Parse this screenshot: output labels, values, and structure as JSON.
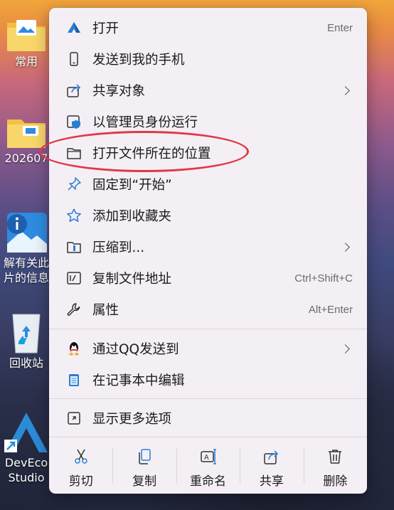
{
  "desktop": {
    "icons": [
      {
        "label": "常用"
      },
      {
        "label": "202607"
      },
      {
        "label_line1": "解有关此",
        "label_line2": "片的信息"
      },
      {
        "label": "回收站"
      },
      {
        "label_line1": "DevEco",
        "label_line2": "Studio"
      }
    ]
  },
  "menu": {
    "items": [
      {
        "label": "打开",
        "shortcut": "Enter",
        "icon": "open-icon"
      },
      {
        "label": "发送到我的手机",
        "icon": "phone-icon"
      },
      {
        "label": "共享对象",
        "icon": "share-icon",
        "submenu": true
      },
      {
        "label": "以管理员身份运行",
        "icon": "admin-shield-icon"
      },
      {
        "label": "打开文件所在的位置",
        "icon": "folder-icon"
      },
      {
        "label": "固定到“开始”",
        "icon": "pin-icon"
      },
      {
        "label": "添加到收藏夹",
        "icon": "star-icon"
      },
      {
        "label": "压缩到...",
        "icon": "zip-icon",
        "submenu": true
      },
      {
        "label": "复制文件地址",
        "shortcut": "Ctrl+Shift+C",
        "icon": "copy-path-icon"
      },
      {
        "label": "属性",
        "shortcut": "Alt+Enter",
        "icon": "wrench-icon"
      },
      {
        "label": "通过QQ发送到",
        "icon": "qq-icon",
        "submenu": true
      },
      {
        "label": "在记事本中编辑",
        "icon": "notepad-icon"
      },
      {
        "label": "显示更多选项",
        "icon": "more-options-icon"
      }
    ],
    "actions": [
      {
        "label": "剪切",
        "icon": "cut-icon"
      },
      {
        "label": "复制",
        "icon": "copy-icon"
      },
      {
        "label": "重命名",
        "icon": "rename-icon"
      },
      {
        "label": "共享",
        "icon": "share-icon"
      },
      {
        "label": "删除",
        "icon": "trash-icon"
      }
    ]
  },
  "colors": {
    "accent": "#1a73e8",
    "highlight_oval": "#e0384a"
  }
}
